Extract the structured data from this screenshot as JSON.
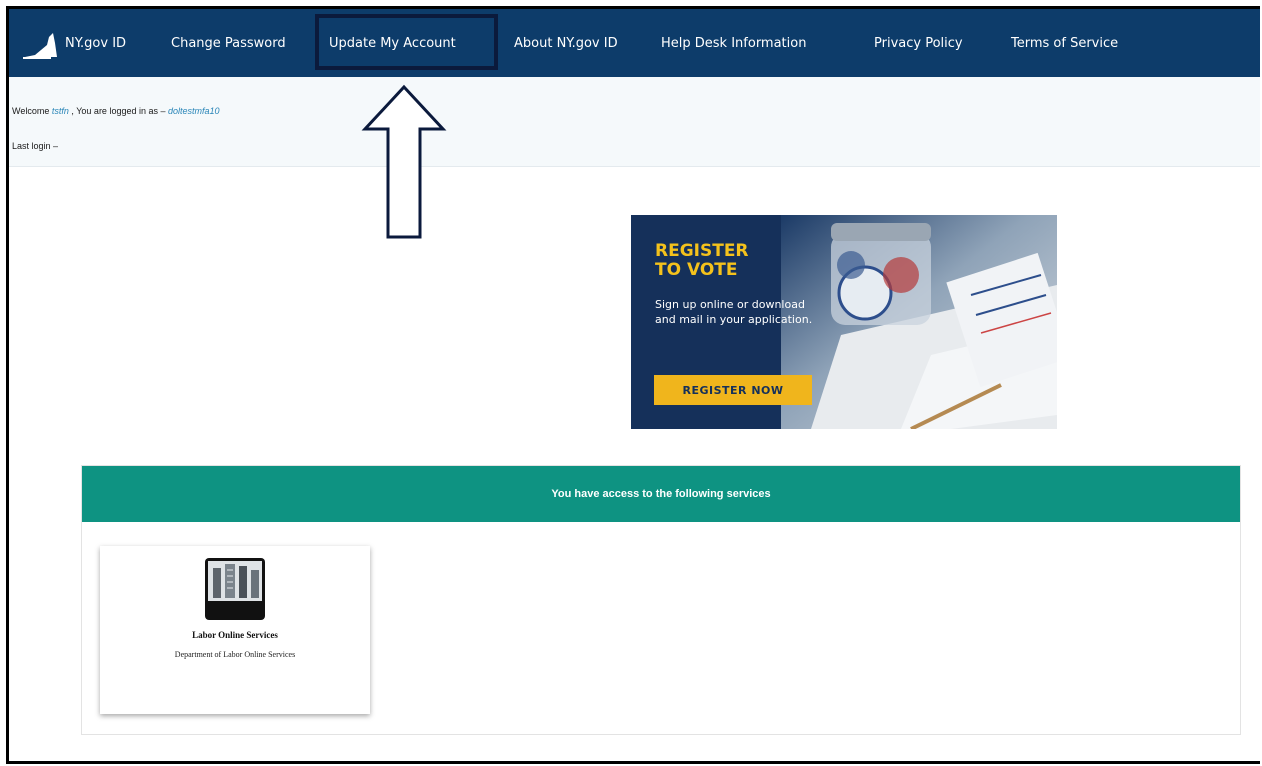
{
  "nav": {
    "items": [
      {
        "label": "NY.gov ID"
      },
      {
        "label": "Change Password"
      },
      {
        "label": "Update My Account"
      },
      {
        "label": "About NY.gov ID"
      },
      {
        "label": "Help Desk Information"
      },
      {
        "label": "Privacy Policy"
      },
      {
        "label": "Terms of Service"
      }
    ]
  },
  "welcome": {
    "prefix": "Welcome",
    "name": "tstfn",
    "middle": ", You are logged in as –",
    "username": "doltestmfa10",
    "last_login": "Last login –"
  },
  "banner": {
    "title_line1": "REGISTER",
    "title_line2": "TO VOTE",
    "text": "Sign up online or download and mail in your application.",
    "button": "REGISTER NOW"
  },
  "services": {
    "header": "You have access to the following services",
    "cards": [
      {
        "title": "Labor Online Services",
        "description": "Department of Labor Online Services"
      }
    ]
  },
  "colors": {
    "nav_bg": "#0d3c6a",
    "header_green": "#0e9382",
    "banner_bg": "#15305a",
    "banner_accent": "#f4c21c"
  }
}
